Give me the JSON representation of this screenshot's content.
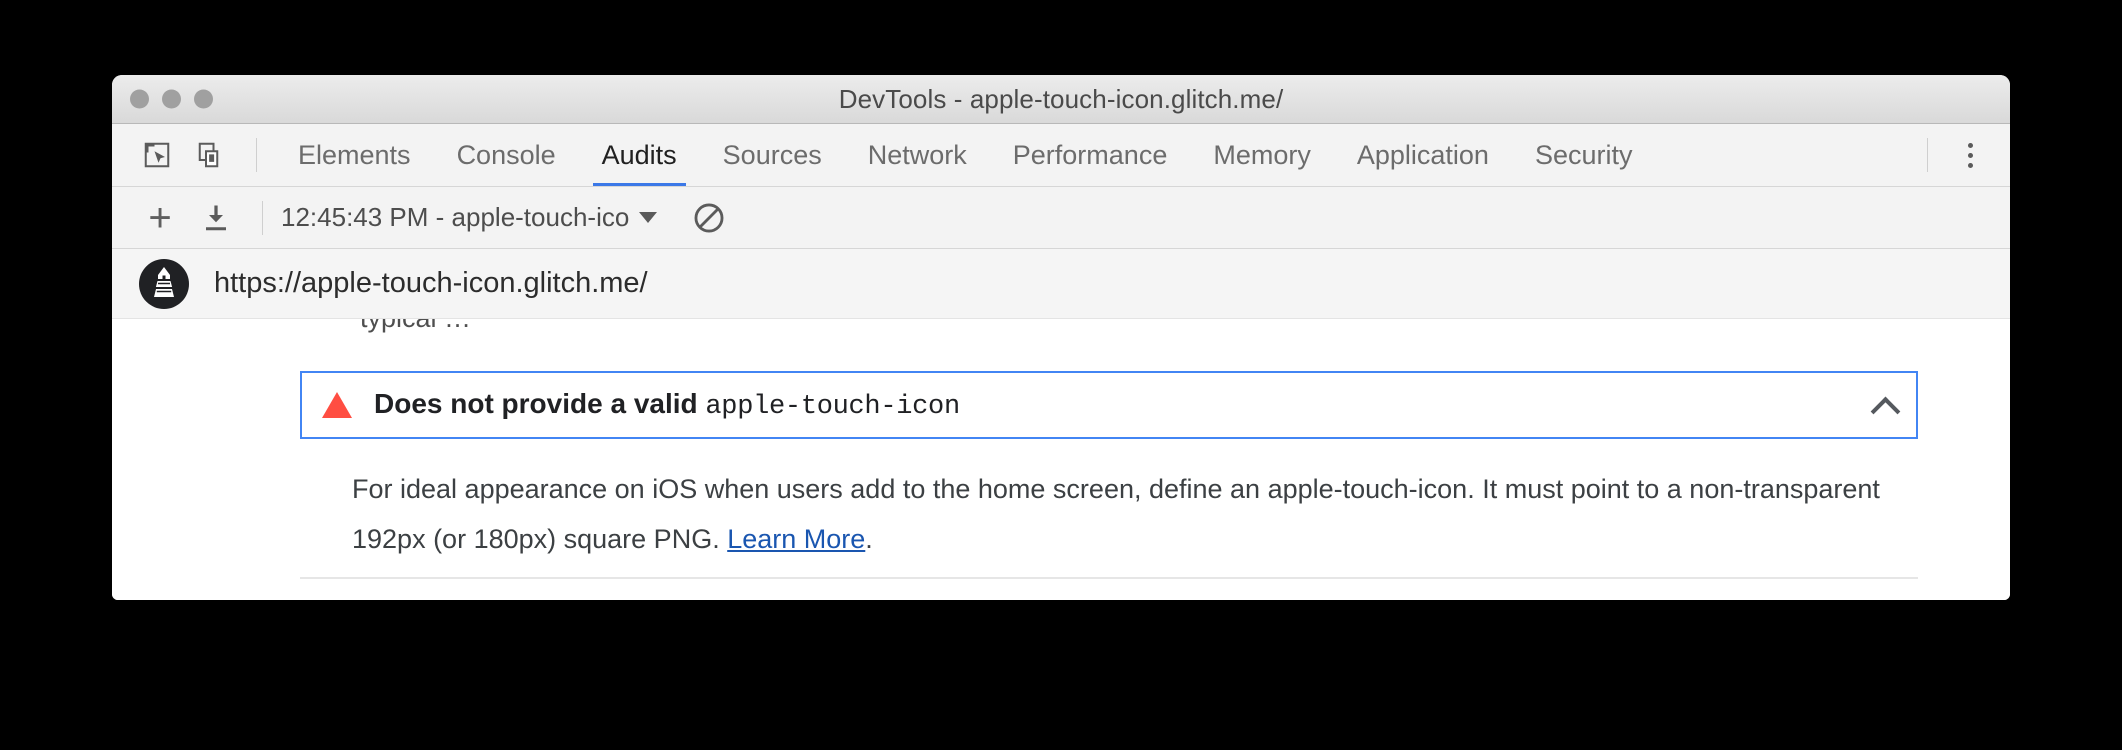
{
  "window": {
    "title": "DevTools - apple-touch-icon.glitch.me/",
    "traffic_lights": [
      "close",
      "minimize",
      "zoom"
    ],
    "traffic_light_color": "#a0a0a0"
  },
  "tabbar": {
    "icons": [
      {
        "name": "inspect-element-icon",
        "label": "Inspect element"
      },
      {
        "name": "device-toolbar-icon",
        "label": "Toggle device toolbar"
      }
    ],
    "tabs": [
      {
        "label": "Elements",
        "active": false
      },
      {
        "label": "Console",
        "active": false
      },
      {
        "label": "Audits",
        "active": true
      },
      {
        "label": "Sources",
        "active": false
      },
      {
        "label": "Network",
        "active": false
      },
      {
        "label": "Performance",
        "active": false
      },
      {
        "label": "Memory",
        "active": false
      },
      {
        "label": "Application",
        "active": false
      },
      {
        "label": "Security",
        "active": false
      }
    ],
    "more_menu_label": "Customize and control DevTools"
  },
  "audits_toolbar": {
    "add_label": "+",
    "add_tooltip": "Perform an audit",
    "import_tooltip": "Import audit",
    "run_selected": "12:45:43 PM - apple-touch-ico",
    "clear_tooltip": "Clear all"
  },
  "url_bar": {
    "logo_name": "lighthouse-logo",
    "url": "https://apple-touch-icon.glitch.me/"
  },
  "report": {
    "clipped_text_above": "typical …",
    "audit": {
      "status": "fail",
      "status_color": "#ff4e42",
      "border_color": "#4285f4",
      "title_prefix": "Does not provide a valid ",
      "title_code": "apple-touch-icon",
      "collapse_icon": "chevron-up-icon",
      "description_part1": "For ideal appearance on iOS when users add to the home screen, define an apple-touch-icon. It must point to a non-transparent 192px (or 180px) square PNG. ",
      "description_link": "Learn More",
      "description_part2": "."
    }
  }
}
